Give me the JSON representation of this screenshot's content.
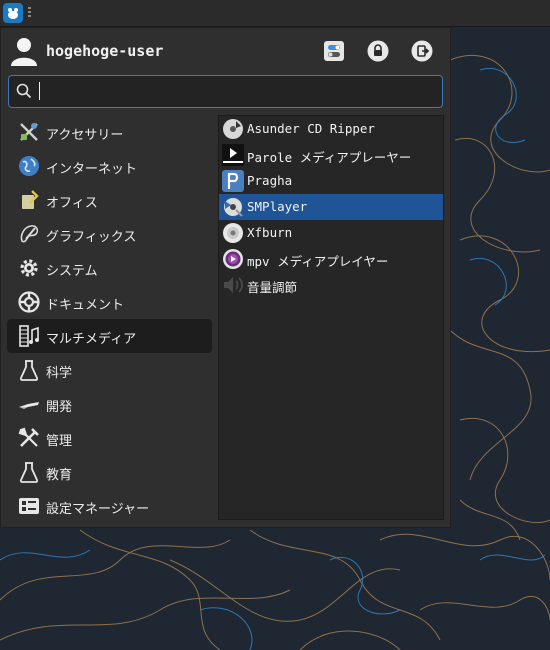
{
  "user": {
    "name": "hogehoge-user"
  },
  "header": {
    "settings_icon": "settings-toggle-icon",
    "lock_icon": "lock-icon",
    "logout_icon": "logout-icon"
  },
  "search": {
    "value": "",
    "placeholder": ""
  },
  "categories": [
    {
      "label": "アクセサリー",
      "icon": "accessories-icon"
    },
    {
      "label": "インターネット",
      "icon": "internet-globe-icon"
    },
    {
      "label": "オフィス",
      "icon": "office-icon"
    },
    {
      "label": "グラフィックス",
      "icon": "graphics-icon"
    },
    {
      "label": "システム",
      "icon": "system-gear-icon"
    },
    {
      "label": "ドキュメント",
      "icon": "documentation-icon"
    },
    {
      "label": "マルチメディア",
      "icon": "multimedia-icon",
      "active": true
    },
    {
      "label": "科学",
      "icon": "science-flask-icon"
    },
    {
      "label": "開発",
      "icon": "development-icon"
    },
    {
      "label": "管理",
      "icon": "administration-tools-icon"
    },
    {
      "label": "教育",
      "icon": "education-flask-icon"
    },
    {
      "label": "設定マネージャー",
      "icon": "settings-manager-icon"
    }
  ],
  "apps": [
    {
      "label": "Asunder CD Ripper",
      "icon": "cd-ripper-icon"
    },
    {
      "label": "Parole メディアプレーヤー",
      "icon": "parole-player-icon"
    },
    {
      "label": "Pragha",
      "icon": "pragha-icon"
    },
    {
      "label": "SMPlayer",
      "icon": "smplayer-icon",
      "selected": true
    },
    {
      "label": "Xfburn",
      "icon": "xfburn-disc-icon"
    },
    {
      "label": "mpv メディアプレイヤー",
      "icon": "mpv-icon"
    },
    {
      "label": "音量調節",
      "icon": "volume-icon"
    }
  ],
  "colors": {
    "accent": "#1f5596",
    "search_border": "#3d79c0",
    "panel": "#2f2f2f"
  }
}
